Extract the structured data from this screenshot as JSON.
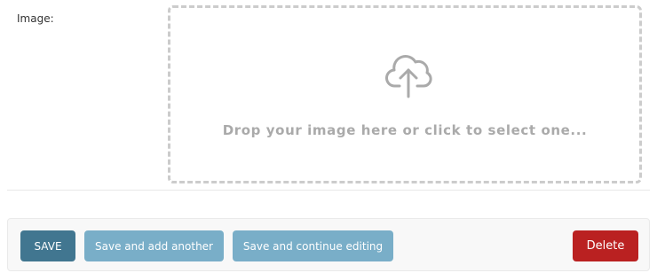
{
  "image_field": {
    "label": "Image:",
    "dropzone_text": "Drop your image here or click to select one..."
  },
  "icons": {
    "upload": "cloud-upload-icon"
  },
  "submit_row": {
    "save": "SAVE",
    "save_add_another": "Save and add another",
    "save_continue": "Save and continue editing",
    "delete": "Delete"
  },
  "colors": {
    "primary": "#417690",
    "secondary": "#79aec8",
    "danger": "#ba2121"
  }
}
